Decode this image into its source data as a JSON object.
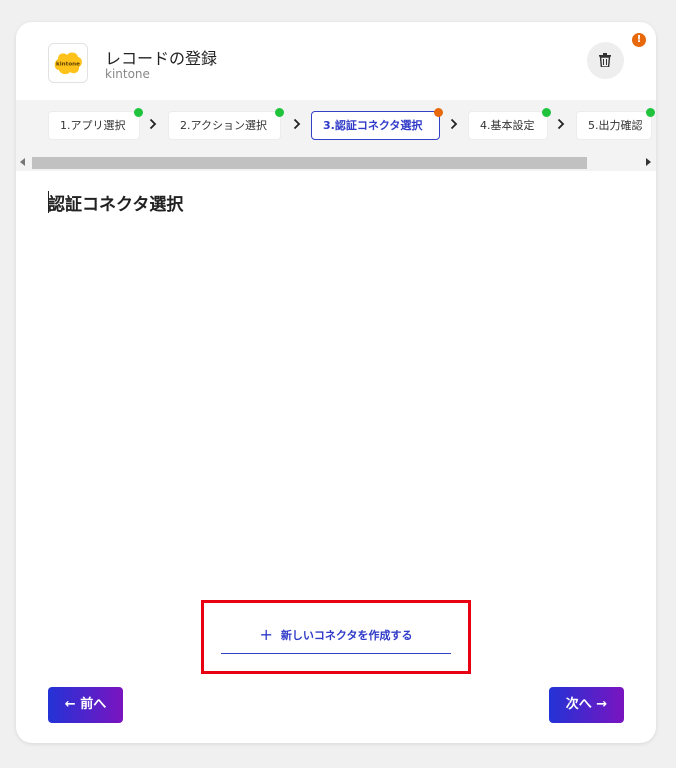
{
  "header": {
    "title": "レコードの登録",
    "subtitle": "kintone",
    "logo_text": "kintone",
    "alert_badge": "!"
  },
  "steps": [
    {
      "label": "1.アプリ選択",
      "status": "done"
    },
    {
      "label": "2.アクション選択",
      "status": "done"
    },
    {
      "label": "3.認証コネクタ選択",
      "status": "warning"
    },
    {
      "label": "4.基本設定",
      "status": "done"
    },
    {
      "label": "5.出力確認",
      "status": "done"
    }
  ],
  "main": {
    "section_title": "認証コネクタ選択",
    "create_connector_label": "新しいコネクタを作成する",
    "create_connector_icon": "+"
  },
  "footer": {
    "prev_label": "← 前へ",
    "next_label": "次へ →"
  },
  "colors": {
    "accent": "#2f3ac8",
    "gradient_start": "#2333d6",
    "gradient_end": "#7a14c0",
    "success": "#1fc43c",
    "warning": "#e8690c",
    "highlight": "#e60012"
  }
}
